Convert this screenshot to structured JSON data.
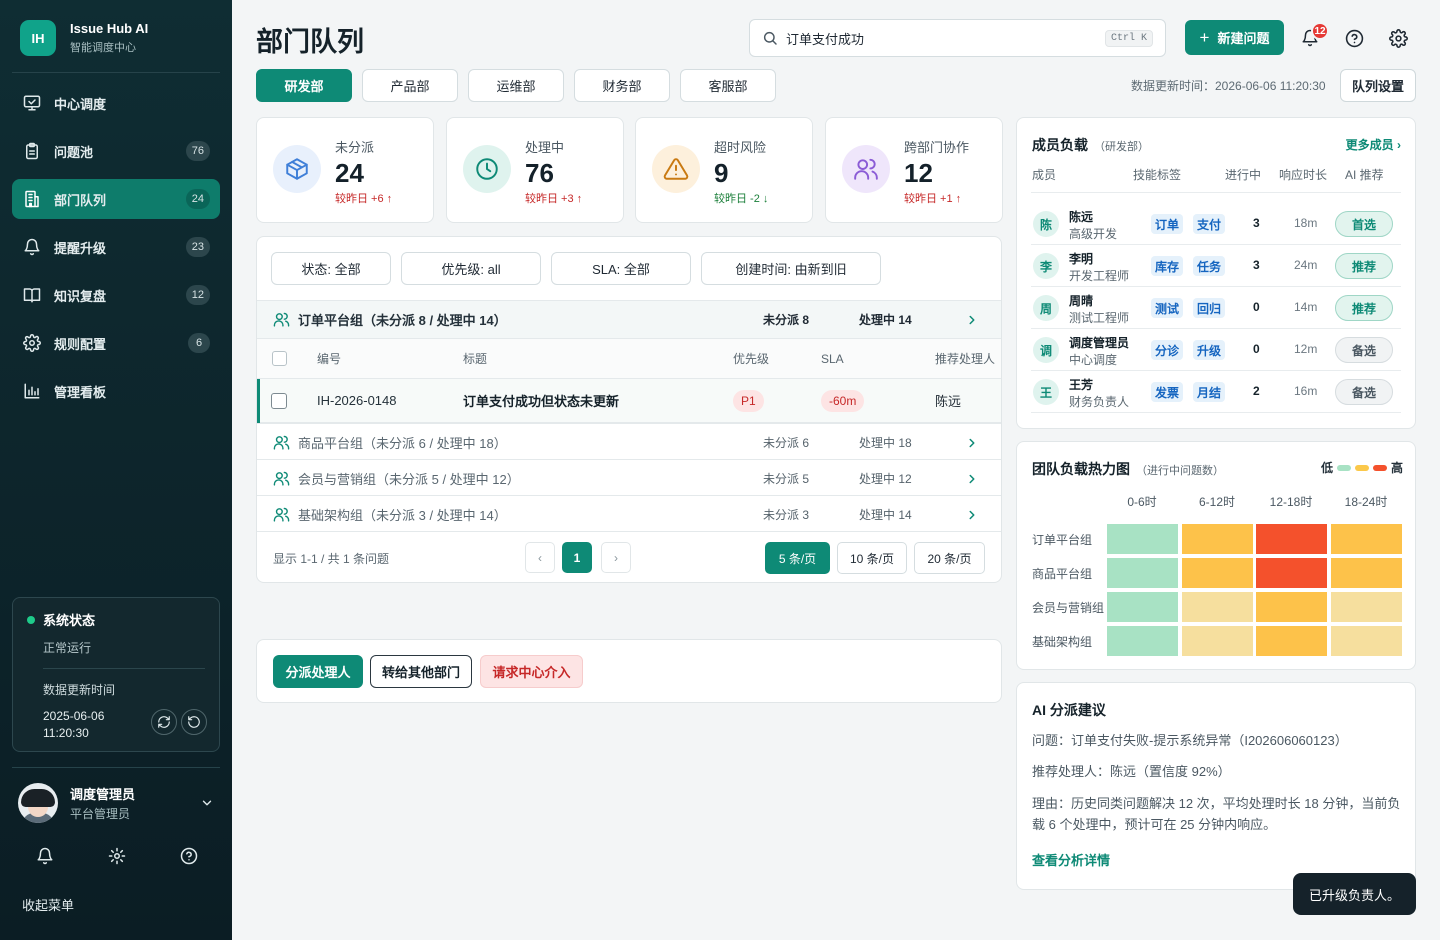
{
  "brand": {
    "logo": "IH",
    "name": "Issue Hub AI",
    "subtitle": "智能调度中心"
  },
  "nav": [
    {
      "label": "中心调度",
      "icon": "monitor-check-icon",
      "badge": ""
    },
    {
      "label": "问题池",
      "icon": "clipboard-icon",
      "badge": "76"
    },
    {
      "label": "部门队列",
      "icon": "building-icon",
      "badge": "24",
      "active": true
    },
    {
      "label": "提醒升级",
      "icon": "bell-icon",
      "badge": "23"
    },
    {
      "label": "知识复盘",
      "icon": "book-icon",
      "badge": "12"
    },
    {
      "label": "规则配置",
      "icon": "gear-icon",
      "badge": "6"
    },
    {
      "label": "管理看板",
      "icon": "bar-chart-icon",
      "badge": ""
    }
  ],
  "system": {
    "title": "系统状态",
    "state": "正常运行",
    "updated_label": "数据更新时间",
    "updated_time": "2025-06-06 11:20:30",
    "status_color": "#1ecb8a"
  },
  "user": {
    "name": "调度管理员",
    "role": "平台管理员"
  },
  "collapse_label": "收起菜单",
  "header": {
    "title": "部门队列",
    "search_value": "订单支付成功",
    "shortcut": "Ctrl K",
    "new_button": "新建问题",
    "notif_count": "12"
  },
  "dept_tabs": [
    "研发部",
    "产品部",
    "运维部",
    "财务部",
    "客服部"
  ],
  "updated_text": "数据更新时间：2026-06-06 11:20:30",
  "queue_settings": "队列设置",
  "stats": [
    {
      "label": "未分派",
      "value": "24",
      "delta": "较昨日 +6 ↑",
      "trend": "up",
      "icon": "box-icon",
      "color": "#3f7fd8",
      "bg": "#e8f0fc"
    },
    {
      "label": "处理中",
      "value": "76",
      "delta": "较昨日 +3 ↑",
      "trend": "up",
      "icon": "clock-icon",
      "color": "#0e8a76",
      "bg": "#dff3ee"
    },
    {
      "label": "超时风险",
      "value": "9",
      "delta": "较昨日 -2 ↓",
      "trend": "down",
      "icon": "warning-icon",
      "color": "#c97a12",
      "bg": "#fdf0dc"
    },
    {
      "label": "跨部门协作",
      "value": "12",
      "delta": "较昨日 +1 ↑",
      "trend": "up",
      "icon": "users-icon",
      "color": "#8b5cd6",
      "bg": "#efe6fb"
    }
  ],
  "filters": [
    "状态: 全部",
    "优先级: all",
    "SLA: 全部",
    "创建时间: 由新到旧"
  ],
  "groups": [
    {
      "name": "订单平台组（未分派 8 / 处理中 14）",
      "unassigned": "未分派 8",
      "processing": "处理中 14"
    },
    {
      "name": "商品平台组（未分派 6 / 处理中 18）",
      "unassigned": "未分派 6",
      "processing": "处理中 18"
    },
    {
      "name": "会员与营销组（未分派 5 / 处理中 12）",
      "unassigned": "未分派 5",
      "processing": "处理中 12"
    },
    {
      "name": "基础架构组（未分派 3 / 处理中 14）",
      "unassigned": "未分派 3",
      "processing": "处理中 14"
    }
  ],
  "table": {
    "headers": [
      "编号",
      "标题",
      "优先级",
      "SLA",
      "推荐处理人"
    ],
    "rows": [
      {
        "id": "IH-2026-0148",
        "title": "订单支付成功但状态未更新",
        "priority": "P1",
        "sla": "-60m",
        "assignee": "陈远"
      }
    ]
  },
  "pagination": {
    "info": "显示 1-1 / 共 1 条问题",
    "prev": "‹",
    "page": "1",
    "next": "›",
    "sizes": [
      "5 条/页",
      "10 条/页",
      "20 条/页"
    ]
  },
  "actions": [
    "分派处理人",
    "转给其他部门",
    "请求中心介入"
  ],
  "members": {
    "title": "成员负载",
    "dept": "（研发部）",
    "more": "更多成员 ›",
    "headers": [
      "成员",
      "技能标签",
      "进行中",
      "响应时长",
      "AI 推荐"
    ],
    "rows": [
      {
        "initial": "陈",
        "name": "陈远",
        "role": "高级开发",
        "tags": [
          "订单",
          "支付"
        ],
        "count": "3",
        "time": "18m",
        "rec": "首选",
        "rec_type": "pri"
      },
      {
        "initial": "李",
        "name": "李明",
        "role": "开发工程师",
        "tags": [
          "库存",
          "任务"
        ],
        "count": "3",
        "time": "24m",
        "rec": "推荐",
        "rec_type": "pri"
      },
      {
        "initial": "周",
        "name": "周晴",
        "role": "测试工程师",
        "tags": [
          "测试",
          "回归"
        ],
        "count": "0",
        "time": "14m",
        "rec": "推荐",
        "rec_type": "pri"
      },
      {
        "initial": "调",
        "name": "调度管理员",
        "role": "中心调度",
        "tags": [
          "分诊",
          "升级"
        ],
        "count": "0",
        "time": "12m",
        "rec": "备选",
        "rec_type": "sec"
      },
      {
        "initial": "王",
        "name": "王芳",
        "role": "财务负责人",
        "tags": [
          "发票",
          "月结"
        ],
        "count": "2",
        "time": "16m",
        "rec": "备选",
        "rec_type": "sec"
      }
    ]
  },
  "heatmap": {
    "title": "团队负载热力图",
    "subtitle": "（进行中问题数）",
    "legend_low": "低",
    "legend_high": "高",
    "legend_colors": [
      "#a8e2c4",
      "#fbc84a",
      "#f4512c"
    ],
    "columns": [
      "0-6时",
      "6-12时",
      "12-18时",
      "18-24时"
    ],
    "rows": [
      "订单平台组",
      "商品平台组",
      "会员与营销组",
      "基础架构组"
    ],
    "levels": [
      [
        1,
        3,
        4,
        3
      ],
      [
        1,
        3,
        4,
        3
      ],
      [
        1,
        2,
        3,
        2
      ],
      [
        1,
        2,
        3,
        2
      ]
    ],
    "palette": {
      "1": "#a8e2c4",
      "2": "#f6df9e",
      "3": "#fdc24a",
      "4": "#f4512c"
    }
  },
  "ai": {
    "title": "AI 分派建议",
    "issue": "问题：订单支付失败-提示系统异常（I202606060123）",
    "assignee": "推荐处理人：陈远（置信度 92%）",
    "reason": "理由：历史同类问题解决 12 次，平均处理时长 18 分钟，当前负载 6 个处理中，预计可在 25 分钟内响应。",
    "link": "查看分析详情"
  },
  "toast": "已升级负责人。",
  "colors": {
    "accent": "#0e8a76",
    "sidebar": "#0f2d33",
    "danger": "#c62828"
  }
}
